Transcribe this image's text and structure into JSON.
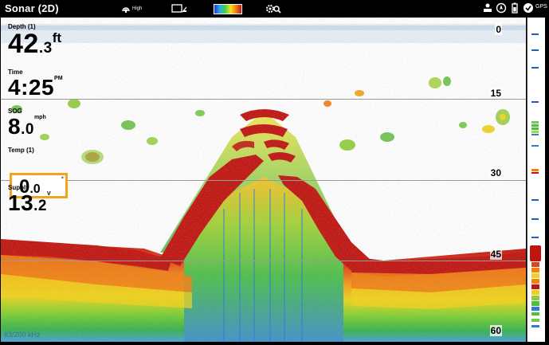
{
  "topbar": {
    "title": "Sonar (2D)",
    "sensitivity_label": "High",
    "icons": [
      "sonar-sensitivity-icon",
      "chart-display-icon",
      "color-palette-icon",
      "settings-search-icon",
      "network-icon",
      "compass-icon",
      "battery-icon",
      "gps-icon"
    ],
    "gps_label": "GPS",
    "palette_colors": [
      "#1d38d8",
      "#2ea8e8",
      "#3fd04a",
      "#f6e218",
      "#f27b16",
      "#c8171a"
    ]
  },
  "readouts": {
    "depth": {
      "label": "Depth (1)",
      "whole": "42",
      "decimal": ".3",
      "unit": "ft"
    },
    "time": {
      "label": "Time",
      "value": "4:25",
      "suffix": "PM"
    },
    "sog": {
      "label": "SOG",
      "whole": "8",
      "decimal": ".0",
      "unit": "mph"
    },
    "temp": {
      "label": "Temp (1)",
      "whole": "0",
      "decimal": ".0",
      "unit": "°"
    },
    "supply": {
      "label": "Supply",
      "whole": "13",
      "decimal": ".2",
      "unit": "V"
    }
  },
  "depth_scale": {
    "marks": [
      "0",
      "15",
      "30",
      "45",
      "60"
    ]
  },
  "frequency_label": "83/200 kHz",
  "colors": {
    "bottom_red": "#c0140f",
    "orange": "#f07f14",
    "yellow": "#f1d21a",
    "green": "#4cc23c",
    "blue": "#2e7bd6",
    "temp_highlight": "#f5a21d"
  }
}
